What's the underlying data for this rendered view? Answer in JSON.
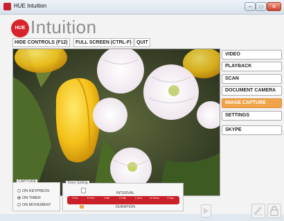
{
  "window": {
    "title": "HUE Intuition",
    "controls": [
      "–",
      "□",
      "✕"
    ]
  },
  "logo": {
    "badge": "HUE",
    "name": "Intuition"
  },
  "top_buttons": [
    "HIDE CONTROLS (F12)",
    "FULL SCREEN (CTRL-F)",
    "QUIT"
  ],
  "sidebar": {
    "items": [
      {
        "label": "VIDEO",
        "active": false
      },
      {
        "label": "PLAYBACK",
        "active": false
      },
      {
        "label": "SCAN",
        "active": false
      },
      {
        "label": "DOCUMENT CAMERA",
        "active": false
      },
      {
        "label": "IMAGE CAPTURE",
        "active": true
      },
      {
        "label": "SETTINGS",
        "active": false
      },
      {
        "label": "SKYPE",
        "active": false
      }
    ]
  },
  "capture": {
    "title": "CAPTURE",
    "options": [
      {
        "label": "ON KEYPRESS",
        "selected": false
      },
      {
        "label": "ON TIMER",
        "selected": true
      },
      {
        "label": "ON MOVEMENT",
        "selected": false
      }
    ]
  },
  "timer": {
    "title": "Timer Setting",
    "interval_label": "INTERVAL",
    "duration_label": "DURATION",
    "ticks": [
      "1 Sec",
      "10 Sec",
      "1 Min",
      "10 Min",
      "1 Hour",
      "12 Hours",
      "1 Day"
    ]
  },
  "colors": {
    "accent": "#f0a44a",
    "brand_red": "#d8232a",
    "timer_bar": "#c9202a"
  },
  "icons": [
    "hue-logo",
    "play-icon",
    "erase-icon",
    "lock-icon"
  ]
}
